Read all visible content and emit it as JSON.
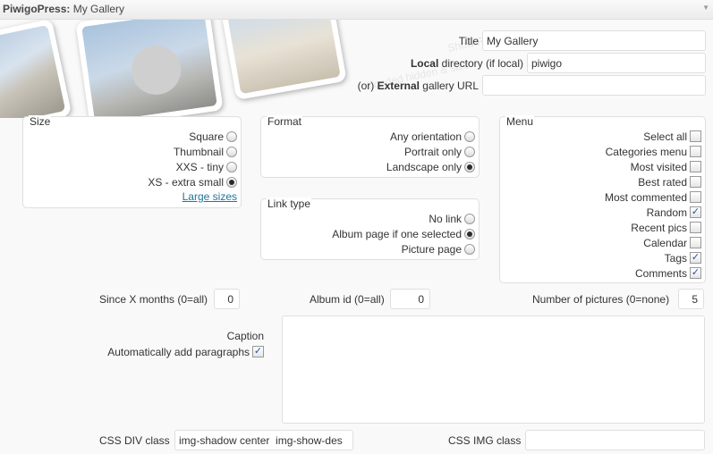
{
  "header": {
    "plugin_name": "PiwigoPress:",
    "widget_title": "My Gallery",
    "collapse_icon": "▼"
  },
  "decor": {
    "ghost_text_1": "Loaded hidden & size",
    "ghost_text_2": "Show Re"
  },
  "title_field": {
    "label": "Title",
    "value": "My Gallery"
  },
  "local_dir": {
    "label_bold": "Local",
    "label_rest": " directory (if local)",
    "value": "piwigo"
  },
  "external_url": {
    "label_pre": "(or) ",
    "label_bold": "External",
    "label_rest": " gallery URL",
    "value": ""
  },
  "size": {
    "legend": "Size",
    "options": [
      {
        "label": "Square",
        "selected": false
      },
      {
        "label": "Thumbnail",
        "selected": false
      },
      {
        "label": "XXS - tiny",
        "selected": false
      },
      {
        "label": "XS - extra small",
        "selected": true
      }
    ],
    "large_sizes_link": "Large sizes"
  },
  "format": {
    "legend": "Format",
    "options": [
      {
        "label": "Any orientation",
        "selected": false
      },
      {
        "label": "Portrait only",
        "selected": false
      },
      {
        "label": "Landscape only",
        "selected": true
      }
    ]
  },
  "link_type": {
    "legend": "Link type",
    "options": [
      {
        "label": "No link",
        "selected": false
      },
      {
        "label": "Album page if one selected",
        "selected": true
      },
      {
        "label": "Picture page",
        "selected": false
      }
    ]
  },
  "menu": {
    "legend": "Menu",
    "items": [
      {
        "label": "Select all",
        "checked": false
      },
      {
        "label": "Categories menu",
        "checked": false
      },
      {
        "label": "Most visited",
        "checked": false
      },
      {
        "label": "Best rated",
        "checked": false
      },
      {
        "label": "Most commented",
        "checked": false
      },
      {
        "label": "Random",
        "checked": true
      },
      {
        "label": "Recent pics",
        "checked": false
      },
      {
        "label": "Calendar",
        "checked": false
      },
      {
        "label": "Tags",
        "checked": true
      },
      {
        "label": "Comments",
        "checked": true
      }
    ]
  },
  "since_months": {
    "label": "Since X months (0=all)",
    "value": "0"
  },
  "album_id": {
    "label": "Album id (0=all)",
    "value": "0"
  },
  "num_pictures": {
    "label": "Number of pictures (0=none)",
    "value": "5"
  },
  "caption": {
    "label": "Caption",
    "value": ""
  },
  "auto_paragraphs": {
    "label": "Automatically add paragraphs",
    "checked": true
  },
  "css_div": {
    "label": "CSS DIV class",
    "value": "img-shadow center  img-show-des"
  },
  "css_img": {
    "label": "CSS IMG class",
    "value": ""
  },
  "colors": {
    "link": "#21759b",
    "border": "#dfdfdf",
    "check": "#2a4fa8"
  }
}
